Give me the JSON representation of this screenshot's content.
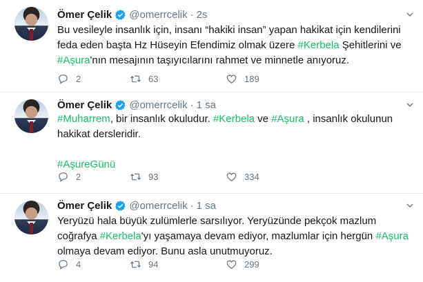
{
  "tweets": [
    {
      "name": "Ömer Çelik",
      "handle": "@omerrcelik",
      "separator": "·",
      "time": "2s",
      "text_segments": [
        {
          "text": "Bu vesileyle insanlık için, insanı “hakiki insan” yapan hakikat için kendilerini feda eden başta Hz Hüseyin Efendimiz olmak üzere ",
          "hashtag": false
        },
        {
          "text": "#Kerbela",
          "hashtag": true
        },
        {
          "text": " Şehitlerini ve ",
          "hashtag": false
        },
        {
          "text": "#Aşura",
          "hashtag": true
        },
        {
          "text": "'nın mesajının taşıyıcılarını rahmet ve minnetle anıyoruz.",
          "hashtag": false
        }
      ],
      "replies": "2",
      "retweets": "63",
      "likes": "189"
    },
    {
      "name": "Ömer Çelik",
      "handle": "@omerrcelik",
      "separator": "·",
      "time": "1 sa",
      "text_segments": [
        {
          "text": "#Muharrem",
          "hashtag": true
        },
        {
          "text": ", bir insanlık okuludur. ",
          "hashtag": false
        },
        {
          "text": "#Kerbela",
          "hashtag": true
        },
        {
          "text": " ve ",
          "hashtag": false
        },
        {
          "text": "#Aşura",
          "hashtag": true
        },
        {
          "text": " , insanlık okulunun hakikat dersleridir.",
          "hashtag": false
        }
      ],
      "extra_line": "#AşureGünü",
      "replies": "2",
      "retweets": "93",
      "likes": "334"
    },
    {
      "name": "Ömer Çelik",
      "handle": "@omerrcelik",
      "separator": "·",
      "time": "1 sa",
      "text_segments": [
        {
          "text": "Yeryüzü hala büyük zulümlerle sarsılıyor. Yeryüzünde pekçok mazlum coğrafya ",
          "hashtag": false
        },
        {
          "text": "#Kerbela",
          "hashtag": true
        },
        {
          "text": "'yı yaşamaya devam ediyor, mazlumlar için hergün ",
          "hashtag": false
        },
        {
          "text": "#Aşura",
          "hashtag": true
        },
        {
          "text": " olmaya devam ediyor. Bunu asla unutmuyoruz.",
          "hashtag": false
        }
      ],
      "replies": "4",
      "retweets": "94",
      "likes": "299"
    }
  ],
  "icons": {
    "verified": "verified-badge-icon",
    "caret": "chevron-down-icon",
    "reply": "reply-icon",
    "retweet": "retweet-icon",
    "like": "heart-icon",
    "share": "share-icon"
  },
  "colors": {
    "hashtag": "#17bf63",
    "verified": "#1da1f2",
    "secondary_text": "#657786"
  }
}
